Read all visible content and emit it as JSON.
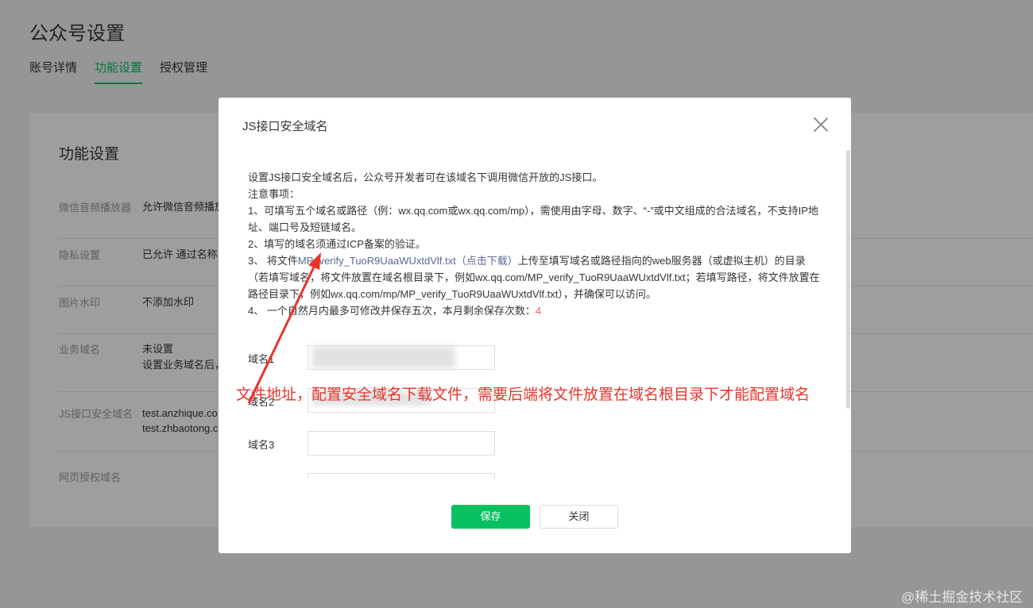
{
  "page": {
    "title": "公众号设置",
    "tabs": [
      {
        "label": "账号详情",
        "active": false
      },
      {
        "label": "功能设置",
        "active": true
      },
      {
        "label": "授权管理",
        "active": false
      }
    ]
  },
  "settings": {
    "title": "功能设置",
    "rows": [
      {
        "label": "微信音频播放器",
        "value": "允许微信音频播放"
      },
      {
        "label": "隐私设置",
        "value": "已允许 通过名称"
      },
      {
        "label": "图片水印",
        "value": "不添加水印"
      },
      {
        "label": "业务域名",
        "value": "未设置",
        "value2": "设置业务域名后，"
      },
      {
        "label": "JS接口安全域名",
        "value": "test.anzhique.co",
        "value2": "test.zhbaotong.c"
      },
      {
        "label": "网页授权域名",
        "value": ""
      }
    ]
  },
  "modal": {
    "title": "JS接口安全域名",
    "intro": "设置JS接口安全域名后，公众号开发者可在该域名下调用微信开放的JS接口。",
    "notice_title": "注意事项：",
    "note1": "1、可填写五个域名或路径（例：wx.qq.com或wx.qq.com/mp），需使用由字母、数字、“-”或中文组成的合法域名，不支持IP地址、端口号及短链域名。",
    "note2": "2、填写的域名须通过ICP备案的验证。",
    "note3_prefix": "3、 将文件",
    "note3_link": "MP_verify_TuoR9UaaWUxtdVlf.txt（点击下载）",
    "note3_suffix": "上传至填写域名或路径指向的web服务器（或虚拟主机）的目录（若填写域名，将文件放置在域名根目录下，例如wx.qq.com/MP_verify_TuoR9UaaWUxtdVlf.txt；若填写路径，将文件放置在路径目录下，例如wx.qq.com/mp/MP_verify_TuoR9UaaWUxtdVlf.txt），并确保可以访问。",
    "note4_prefix": "4、 一个自然月内最多可修改并保存五次，本月剩余保存次数：",
    "note4_count": "4",
    "domains": [
      {
        "label": "域名1",
        "value": ""
      },
      {
        "label": "域名2",
        "value": ""
      },
      {
        "label": "域名3",
        "value": ""
      }
    ],
    "save_label": "保存",
    "close_label": "关闭"
  },
  "annotation": "文件地址，配置安全域名下载文件，需要后端将文件放置在域名根目录下才能配置域名",
  "watermark": "@稀土掘金技术社区",
  "colors": {
    "accent_green": "#07c160",
    "link_blue": "#576b95",
    "annotation_red": "#e8342b"
  }
}
